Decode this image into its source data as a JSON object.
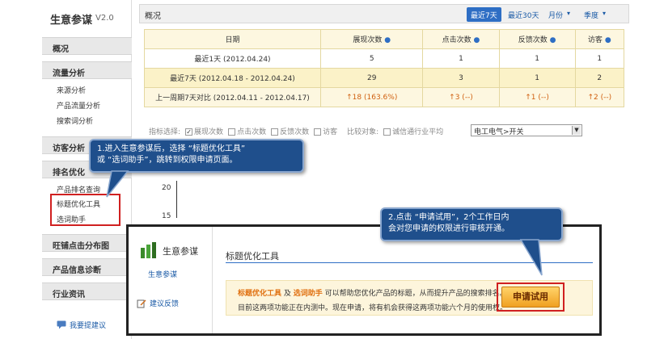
{
  "sidebar": {
    "app_title": "生意参谋",
    "version": "V2.0",
    "groups": {
      "overview": "概况",
      "traffic": "流量分析",
      "visitor": "访客分析",
      "rank": "排名优化",
      "wangpu": "旺铺点击分布图",
      "product_diag": "产品信息诊断",
      "industry": "行业资讯"
    },
    "items": {
      "source": "来源分析",
      "product_traffic": "产品流量分析",
      "search_term": "搜索词分析",
      "product_rank": "产品排名查询",
      "title_opt": "标题优化工具",
      "word_helper": "选词助手"
    },
    "feedback": "我要提建议"
  },
  "topbar": {
    "title": "概况",
    "tabs": [
      "最近7天",
      "最近30天",
      "月份",
      "季度"
    ]
  },
  "stats": {
    "headers": [
      "日期",
      "展现次数",
      "点击次数",
      "反馈次数",
      "访客"
    ],
    "rows": [
      [
        "最近1天 (2012.04.24)",
        "5",
        "1",
        "1",
        "1"
      ],
      [
        "最近7天 (2012.04.18 - 2012.04.24)",
        "29",
        "3",
        "1",
        "2"
      ],
      [
        "上一周期7天对比 (2012.04.11 - 2012.04.17)",
        "18 (163.6%)",
        "3 (--)",
        "1 (--)",
        "2 (--)"
      ]
    ]
  },
  "filter": {
    "label": "指标选择:",
    "options": [
      "展现次数",
      "点击次数",
      "反馈次数",
      "访客"
    ],
    "compare_label": "比较对象:",
    "compare_option": "诚信通行业平均",
    "select_value": "电工电气>开关"
  },
  "chart": {
    "ticks": [
      "20",
      "15"
    ]
  },
  "callouts": {
    "one_line1": "1.进入生意参谋后，选择 “标题优化工具”",
    "one_line2": "或 “选词助手”，跳转到权限申请页面。",
    "two_line1": "2.点击 “申请试用”，2个工作日内",
    "two_line2": "会对您申请的权限进行审核开通。"
  },
  "popup": {
    "app_name": "生意参谋",
    "sub_link": "生意参谋",
    "feedback": "建议反馈",
    "heading": "标题优化工具",
    "notice_hl1": "标题优化工具",
    "notice_and": " 及 ",
    "notice_hl2": "选词助手",
    "notice_rest": " 可以帮助您优化产品的标题，从而提升产品的搜索排名。",
    "notice_line2": "目前这两项功能正在内测中。现在申请，将有机会获得这两项功能六个月的使用权。",
    "apply_button": "申请试用"
  },
  "colors": {
    "accent": "#2e6ec4",
    "callout_bg": "#1f4f8c",
    "highlight_red": "#d02020",
    "up_orange": "#d06010"
  }
}
